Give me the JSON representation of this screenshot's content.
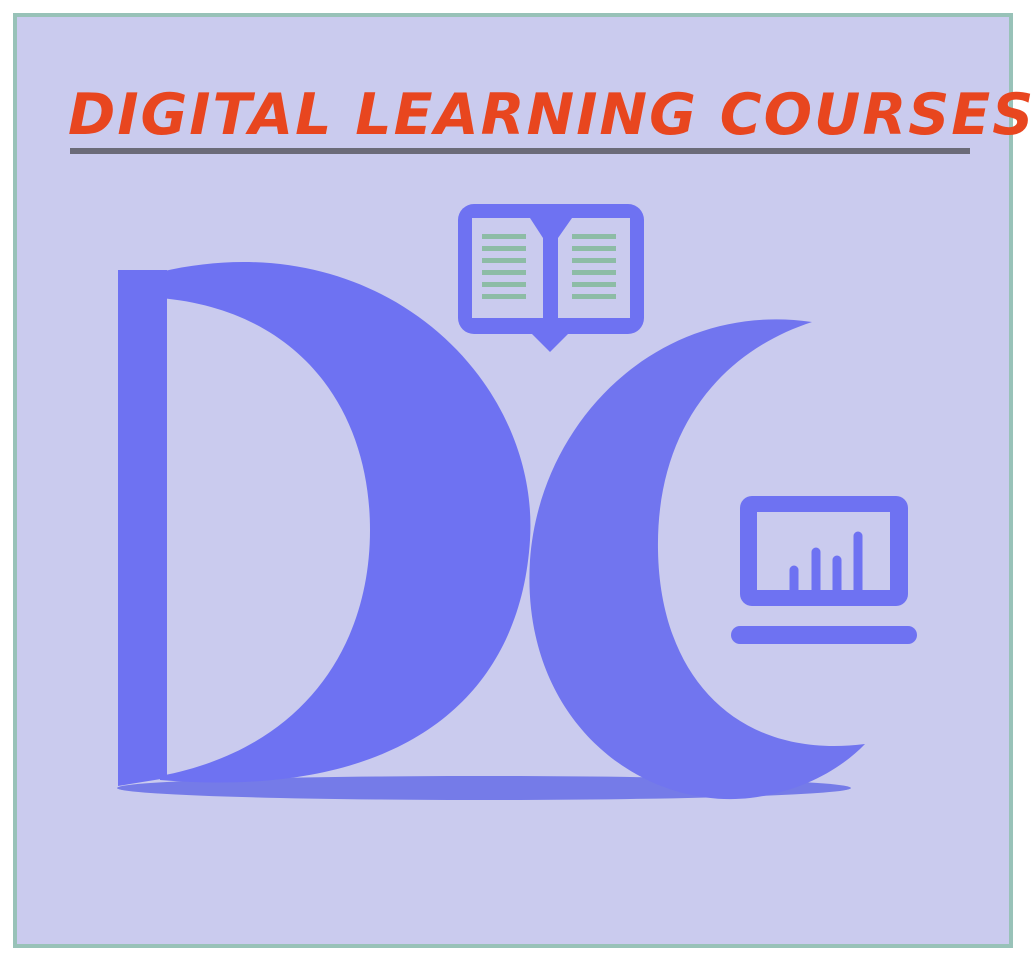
{
  "title": {
    "text": "DIGITAL LEARNING COURSES"
  },
  "colors": {
    "background": "#cacbee",
    "border": "#98c2b8",
    "title": "#e8461f",
    "underline": "#6b6b78",
    "logo": "#6e72f2",
    "logo_shadow": "#757be8",
    "book_lines": "#8dbca6",
    "screen_fill": "#cacbee"
  },
  "icons": {
    "book": "open-book-icon",
    "laptop": "laptop-chart-icon"
  }
}
